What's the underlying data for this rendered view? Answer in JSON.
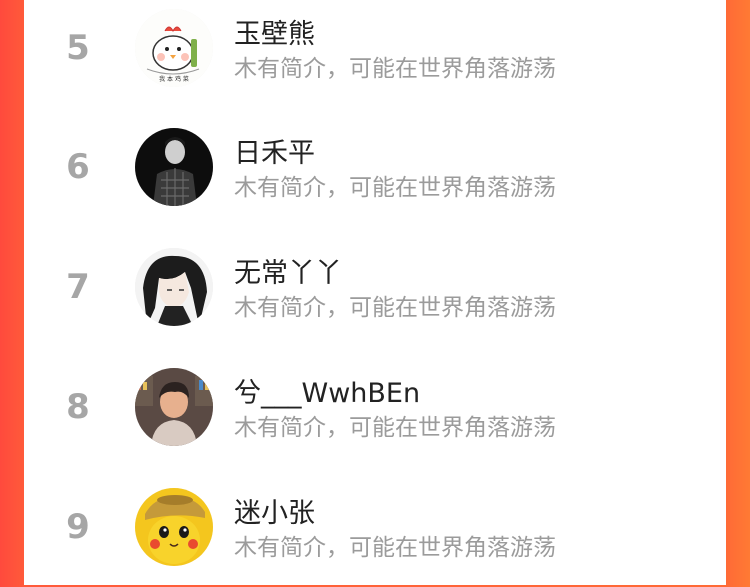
{
  "ranking": {
    "items": [
      {
        "rank": "5",
        "name": "玉壁熊",
        "bio": "木有简介，可能在世界角落游荡",
        "avatar_icon": "cartoon-chicken-avatar-icon"
      },
      {
        "rank": "6",
        "name": "日禾平",
        "bio": "木有简介，可能在世界角落游荡",
        "avatar_icon": "dark-portrait-avatar-icon"
      },
      {
        "rank": "7",
        "name": "无常丫丫",
        "bio": "木有简介，可能在世界角落游荡",
        "avatar_icon": "anime-boy-avatar-icon"
      },
      {
        "rank": "8",
        "name": "兮___WwhBEn",
        "bio": "木有简介，可能在世界角落游荡",
        "avatar_icon": "illustrated-boy-avatar-icon"
      },
      {
        "rank": "9",
        "name": "迷小张",
        "bio": "木有简介，可能在世界角落游荡",
        "avatar_icon": "pikachu-avatar-icon"
      }
    ]
  },
  "colors": {
    "background_gradient_left": "#ff4a3d",
    "background_gradient_right": "#ff7a34",
    "rank_gray": "#a6a6a6",
    "bio_gray": "#9b9b9b"
  }
}
